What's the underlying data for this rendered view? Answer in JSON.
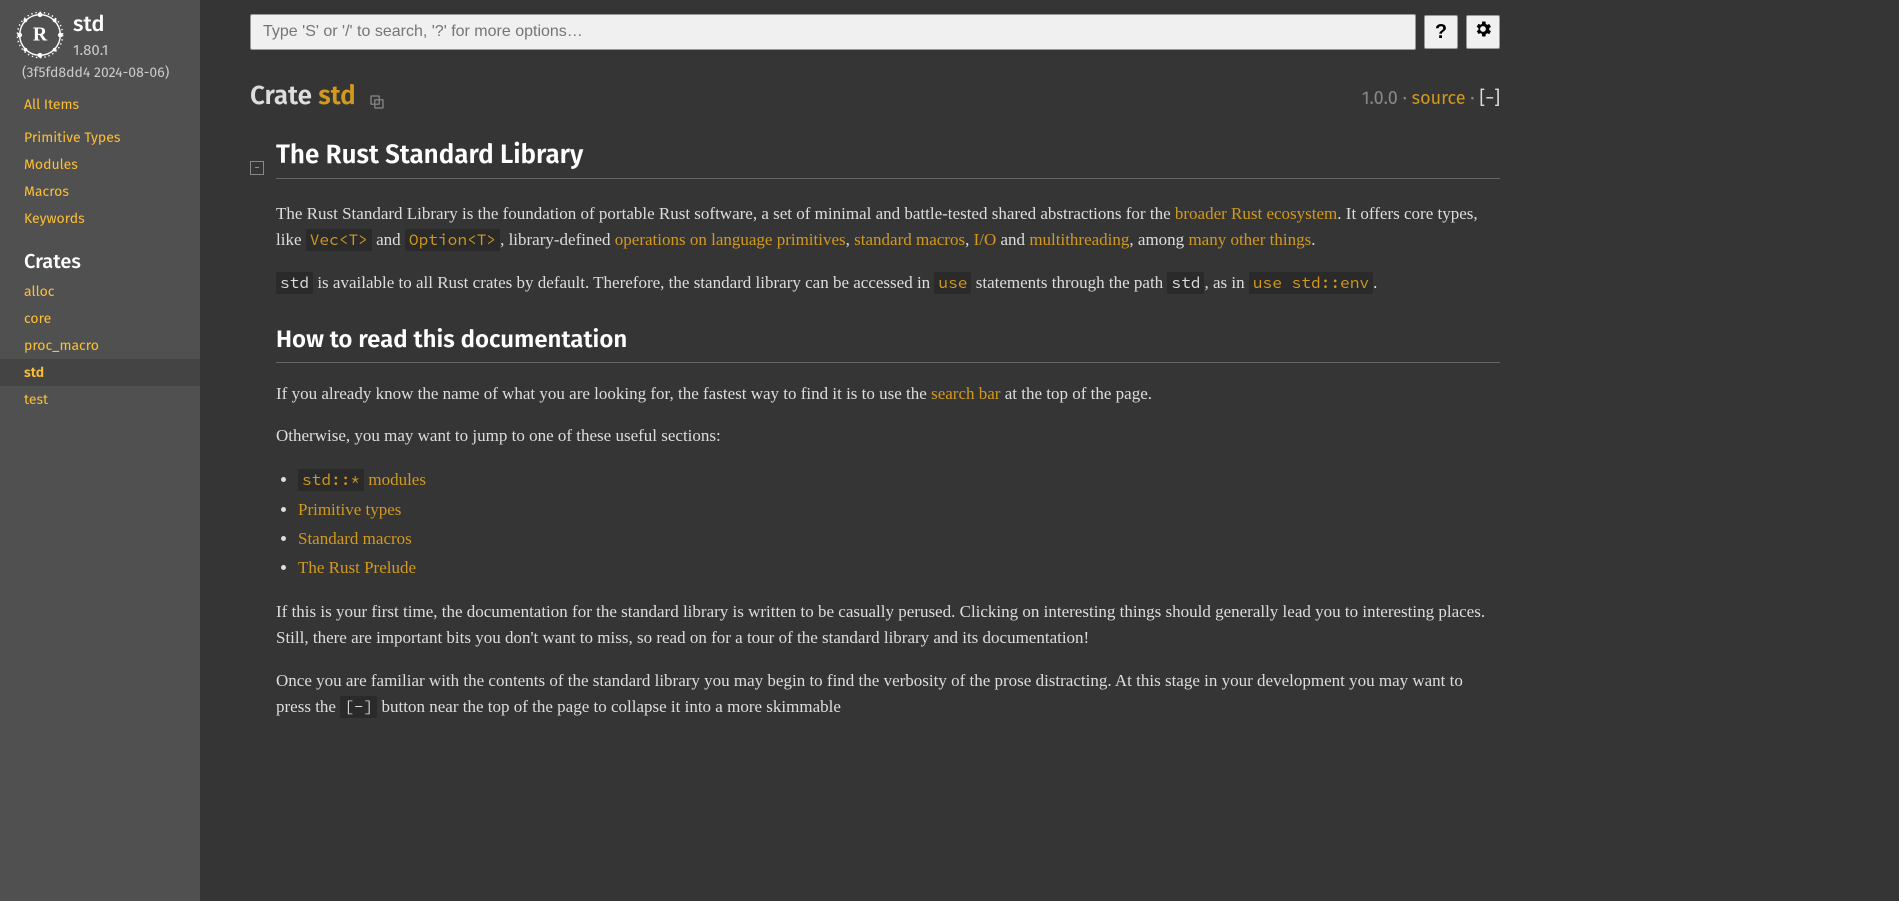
{
  "sidebar": {
    "crate_name": "std",
    "version": "1.80.1",
    "meta": "(3f5fd8dd4 2024-08-06)",
    "all_items": "All Items",
    "nav": [
      "Primitive Types",
      "Modules",
      "Macros",
      "Keywords"
    ],
    "crates_heading": "Crates",
    "crates": [
      "alloc",
      "core",
      "proc_macro",
      "std",
      "test"
    ],
    "current_crate": "std"
  },
  "search": {
    "placeholder": "Type 'S' or '/' to search, '?' for more options…"
  },
  "heading": {
    "prefix": "Crate ",
    "name": "std",
    "since": "1.0.0",
    "source": "source",
    "collapse": "[−]"
  },
  "doc": {
    "h1": "The Rust Standard Library",
    "p1_a": "The Rust Standard Library is the foundation of portable Rust software, a set of minimal and battle-tested shared abstractions for the ",
    "p1_link1": "broader Rust ecosystem",
    "p1_b": ". It offers core types, like ",
    "p1_code1": "Vec<T>",
    "p1_c": " and ",
    "p1_code2": "Option<T>",
    "p1_d": ", library-defined ",
    "p1_link2": "operations on language primitives",
    "p1_e": ", ",
    "p1_link3": "standard macros",
    "p1_f": ", ",
    "p1_link4": "I/O",
    "p1_g": " and ",
    "p1_link5": "multithreading",
    "p1_h": ", among ",
    "p1_link6": "many other things",
    "p1_i": ".",
    "p2_code1": "std",
    "p2_a": " is available to all Rust crates by default. Therefore, the standard library can be accessed in ",
    "p2_code2": "use",
    "p2_b": " statements through the path ",
    "p2_code3": "std",
    "p2_c": ", as in ",
    "p2_code4": "use std::env",
    "p2_d": ".",
    "h2": "How to read this documentation",
    "p3_a": "If you already know the name of what you are looking for, the fastest way to find it is to use the ",
    "p3_link1": "search bar",
    "p3_b": " at the top of the page.",
    "p4": "Otherwise, you may want to jump to one of these useful sections:",
    "list": [
      {
        "code": "std::*",
        "text": " modules"
      },
      {
        "text": "Primitive types"
      },
      {
        "text": "Standard macros"
      },
      {
        "text": "The Rust Prelude"
      }
    ],
    "p5": "If this is your first time, the documentation for the standard library is written to be casually perused. Clicking on interesting things should generally lead you to interesting places. Still, there are important bits you don't want to miss, so read on for a tour of the standard library and its documentation!",
    "p6_a": "Once you are familiar with the contents of the standard library you may begin to find the verbosity of the prose distracting. At this stage in your development you may want to press the ",
    "p6_code": "[-]",
    "p6_b": " button near the top of the page to collapse it into a more skimmable"
  }
}
